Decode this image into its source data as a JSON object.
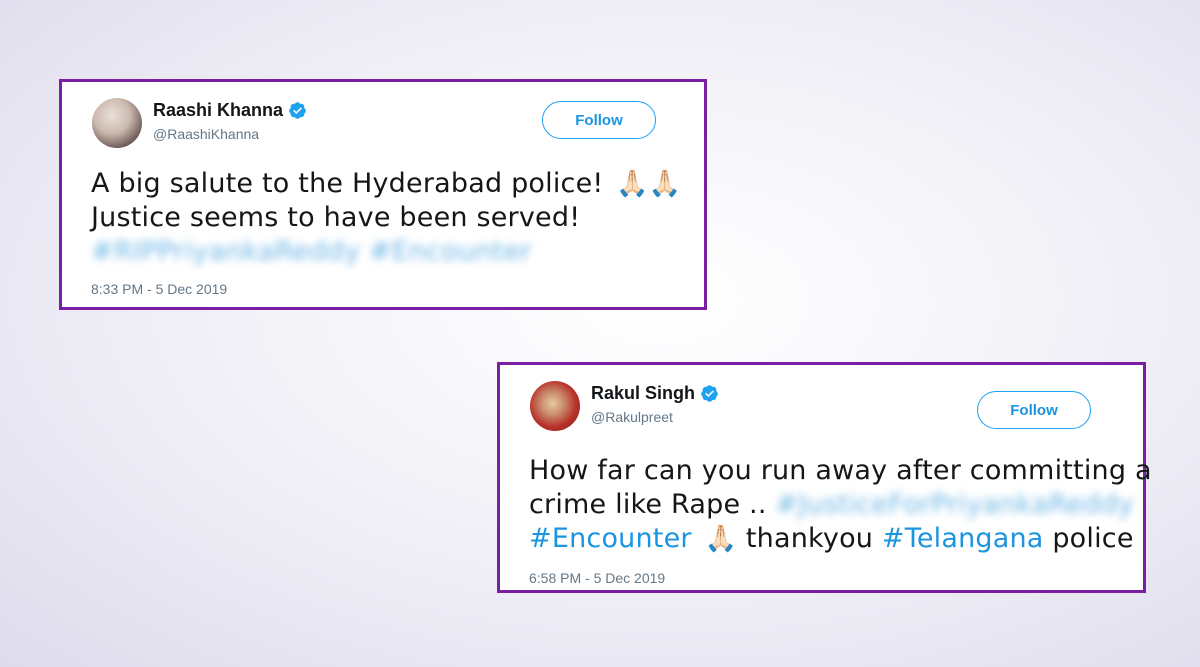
{
  "tweets": [
    {
      "display_name": "Raashi Khanna",
      "handle": "@RaashiKhanna",
      "follow_label": "Follow",
      "verified_icon": "verified-badge-icon",
      "line1": "A big salute to the Hyderabad police!",
      "line1_emoji": "🙏🏻🙏🏻",
      "line2": "Justice seems to have been served!",
      "blurred_hashtags": "#RIPPriyankaReddy #Encounter",
      "timestamp": "8:33 PM - 5 Dec 2019"
    },
    {
      "display_name": "Rakul Singh",
      "handle": "@Rakulpreet",
      "follow_label": "Follow",
      "verified_icon": "verified-badge-icon",
      "line1": "How far can you run away after committing a",
      "line2_text": "crime like Rape ..",
      "blurred_hashtag": "#JusticeForPriyankaReddy",
      "line3_hashtag1": "#Encounter",
      "line3_emoji": "🙏🏻",
      "line3_text": "thankyou",
      "line3_hashtag2": "#Telangana",
      "line3_end": "police",
      "timestamp": "6:58 PM - 5 Dec 2019"
    }
  ],
  "colors": {
    "card_border": "#7a1fa2",
    "link_blue": "#1b95e0",
    "follow_border": "#1da1f2",
    "muted_gray": "#657786"
  }
}
